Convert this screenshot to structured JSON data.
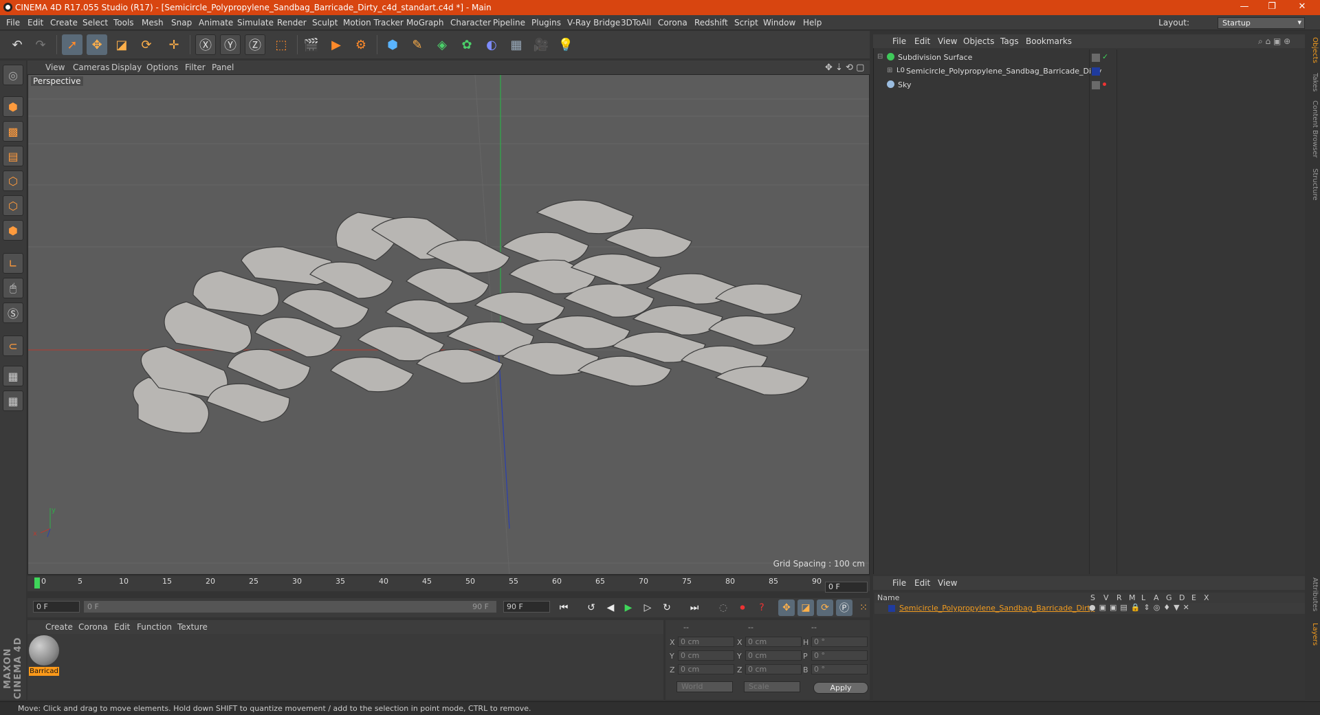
{
  "window": {
    "title": "CINEMA 4D R17.055 Studio (R17) - [Semicircle_Polypropylene_Sandbag_Barricade_Dirty_c4d_standart.c4d *] - Main",
    "controls": [
      "—",
      "❐",
      "✕"
    ]
  },
  "menubar": {
    "items": [
      "File",
      "Edit",
      "Create",
      "Select",
      "Tools",
      "Mesh",
      "Snap",
      "Animate",
      "Simulate",
      "Render",
      "Sculpt",
      "Motion Tracker",
      "MoGraph",
      "Character",
      "Pipeline",
      "Plugins",
      "V-Ray Bridge",
      "3DToAll",
      "Corona",
      "Redshift",
      "Script",
      "Window",
      "Help"
    ],
    "layout_label": "Layout:",
    "layout_value": "Startup"
  },
  "viewport": {
    "menu": [
      "View",
      "Cameras",
      "Display",
      "Options",
      "Filter",
      "Panel"
    ],
    "label": "Perspective",
    "grid_spacing": "Grid Spacing : 100 cm",
    "axis_x": "x",
    "axis_y": "y"
  },
  "timeline": {
    "ticks": [
      "0",
      "5",
      "10",
      "15",
      "20",
      "25",
      "30",
      "35",
      "40",
      "45",
      "50",
      "55",
      "60",
      "65",
      "70",
      "75",
      "80",
      "85",
      "90"
    ],
    "current_frame": "0 F",
    "start_field": "0 F",
    "range_start": "0 F",
    "range_end": "90 F",
    "end_field": "90 F"
  },
  "material_manager": {
    "menu": [
      "Create",
      "Corona",
      "Edit",
      "Function",
      "Texture"
    ],
    "material_name": "Barricad"
  },
  "coordinates": {
    "headers": [
      "--",
      "--",
      "--"
    ],
    "rows": [
      {
        "l1": "X",
        "v1": "0 cm",
        "l2": "X",
        "v2": "0 cm",
        "l3": "H",
        "v3": "0 °"
      },
      {
        "l1": "Y",
        "v1": "0 cm",
        "l2": "Y",
        "v2": "0 cm",
        "l3": "P",
        "v3": "0 °"
      },
      {
        "l1": "Z",
        "v1": "0 cm",
        "l2": "Z",
        "v2": "0 cm",
        "l3": "B",
        "v3": "0 °"
      }
    ],
    "mode1": "World",
    "mode2": "Scale",
    "apply": "Apply"
  },
  "object_manager": {
    "menu": [
      "File",
      "Edit",
      "View",
      "Objects",
      "Tags",
      "Bookmarks"
    ],
    "objects": [
      "Subdivision Surface",
      "Semicircle_Polypropylene_Sandbag_Barricade_Dirty",
      "Sky"
    ]
  },
  "layer_manager": {
    "menu": [
      "File",
      "Edit",
      "View"
    ],
    "name_header": "Name",
    "columns": [
      "S",
      "V",
      "R",
      "M",
      "L",
      "A",
      "G",
      "D",
      "E",
      "X"
    ],
    "layer_name": "Semicircle_Polypropylene_Sandbag_Barricade_Dirty"
  },
  "side_tabs": [
    "Objects",
    "Takes",
    "Content Browser",
    "Structure"
  ],
  "side_tabs_bottom": [
    "Attributes",
    "Layers"
  ],
  "status": "Move: Click and drag to move elements. Hold down SHIFT to quantize movement / add to the selection in point mode, CTRL to remove.",
  "brand": "MAXON CINEMA 4D",
  "colors": {
    "title_bar": "#d84510",
    "accent": "#f39c1e",
    "axis_x": "#c0392b",
    "axis_y": "#27ae60",
    "axis_z": "#2c3e9e"
  }
}
